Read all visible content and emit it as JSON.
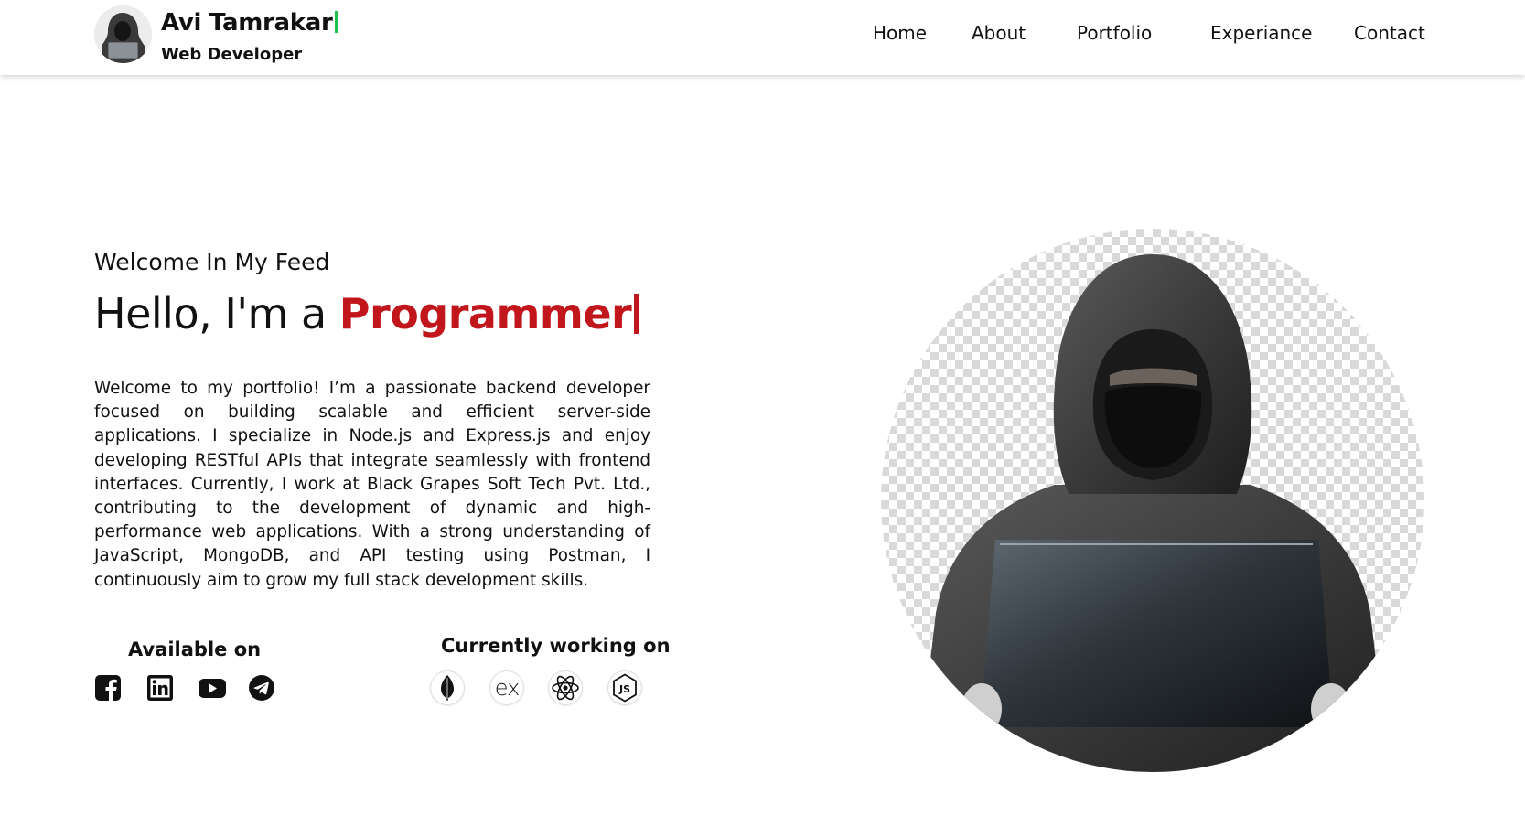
{
  "header": {
    "brand_name": "Avi Tamrakar",
    "brand_role": "Web Developer",
    "nav": [
      {
        "label": "Home"
      },
      {
        "label": "About"
      },
      {
        "label": "Portfolio"
      },
      {
        "label": "Experiance"
      },
      {
        "label": "Contact"
      }
    ]
  },
  "hero": {
    "welcome": "Welcome In My Feed",
    "hello_prefix": "Hello, I'm a",
    "role_word": "Programmer",
    "intro": "Welcome to my portfolio! I’m a passionate backend developer focused on building scalable and efficient server-side applications. I specialize in Node.js and Express.js and enjoy developing RESTful APIs that integrate seamlessly with frontend interfaces. Currently, I work at Black Grapes Soft Tech Pvt. Ltd., contributing to the development of dynamic and high-performance web applications. With a strong understanding of JavaScript, MongoDB, and API testing using Postman, I continuously aim to grow my full stack development skills.",
    "available_title": "Available on",
    "working_title": "Currently working on",
    "social_icons": [
      "facebook-icon",
      "linkedin-icon",
      "youtube-icon",
      "telegram-icon"
    ],
    "tech_icons": [
      "mongodb-icon",
      "express-icon",
      "react-icon",
      "nodejs-icon"
    ],
    "express_text": "ex",
    "js_text": "JS"
  },
  "colors": {
    "accent_red": "#c0161c",
    "cursor_green": "#1fbf4e"
  }
}
